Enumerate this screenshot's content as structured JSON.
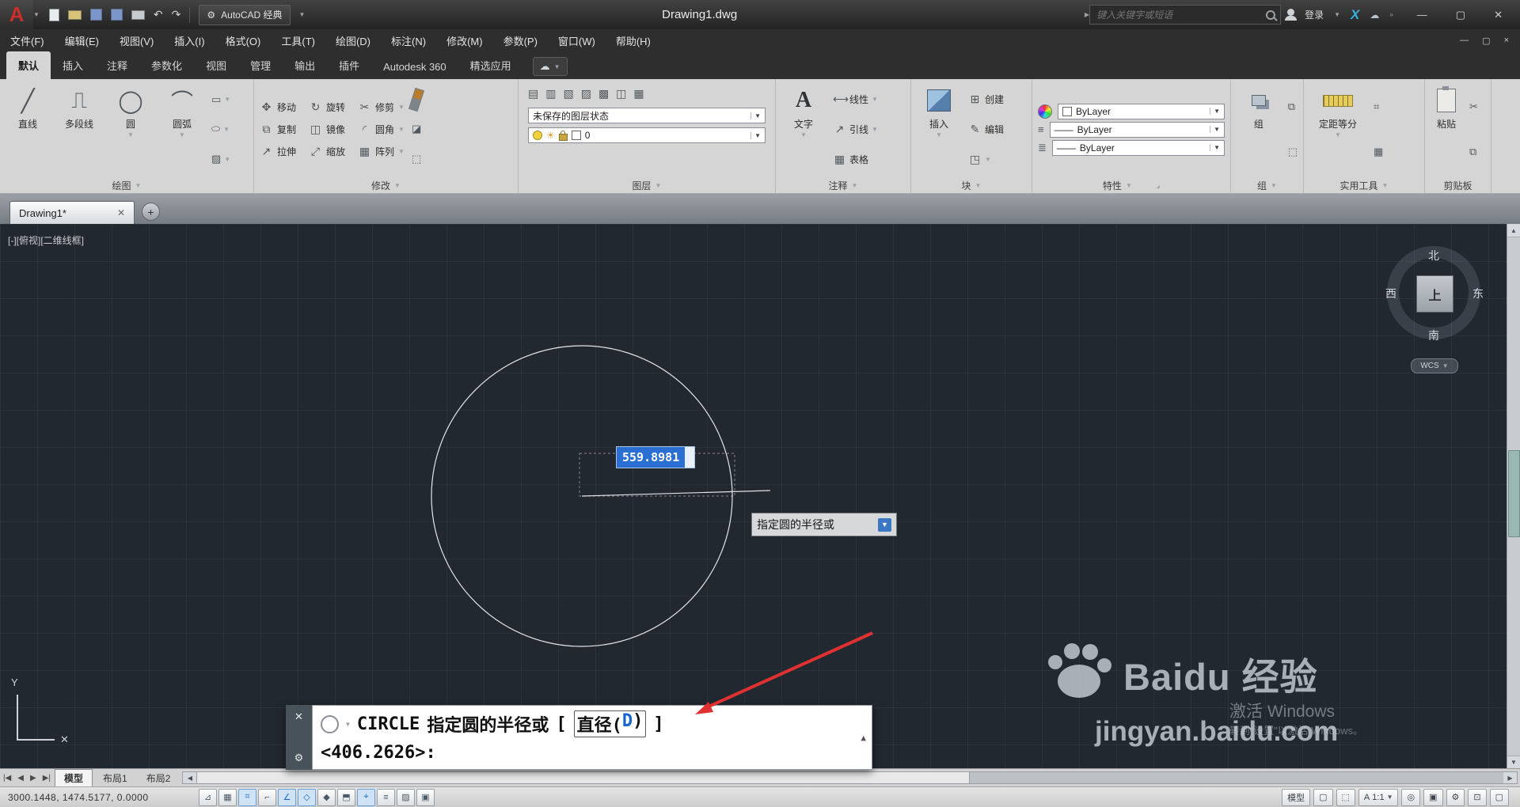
{
  "titlebar": {
    "workspace": "AutoCAD 经典",
    "doc_title": "Drawing1.dwg",
    "search_placeholder": "键入关键字或短语",
    "login": "登录"
  },
  "menubar": {
    "items": [
      "文件(F)",
      "编辑(E)",
      "视图(V)",
      "插入(I)",
      "格式(O)",
      "工具(T)",
      "绘图(D)",
      "标注(N)",
      "修改(M)",
      "参数(P)",
      "窗口(W)",
      "帮助(H)"
    ]
  },
  "ribbon": {
    "tabs": [
      "默认",
      "插入",
      "注释",
      "参数化",
      "视图",
      "管理",
      "输出",
      "插件",
      "Autodesk 360",
      "精选应用"
    ],
    "panels": {
      "draw": {
        "title": "绘图",
        "line": "直线",
        "polyline": "多段线",
        "circle": "圆",
        "arc": "圆弧"
      },
      "modify": {
        "title": "修改",
        "move": "移动",
        "rotate": "旋转",
        "trim": "修剪",
        "copy": "复制",
        "mirror": "镜像",
        "fillet": "圆角",
        "stretch": "拉伸",
        "scale": "缩放",
        "array": "阵列"
      },
      "layers": {
        "title": "图层",
        "state": "未保存的图层状态",
        "layer": "0"
      },
      "annotate": {
        "title": "注释",
        "icon_letter": "A",
        "text": "文字",
        "linear": "线性",
        "leader": "引线",
        "table": "表格"
      },
      "block": {
        "title": "块",
        "insert": "插入",
        "create": "创建",
        "edit": "编辑"
      },
      "properties": {
        "title": "特性",
        "v1": "ByLayer",
        "v2": "ByLayer",
        "v3": "ByLayer"
      },
      "groups": {
        "title": "组",
        "group": "组"
      },
      "utilities": {
        "title": "实用工具",
        "measure": "定距等分"
      },
      "clipboard": {
        "title": "剪贴板",
        "paste": "粘贴"
      }
    }
  },
  "doc_tabs": {
    "active": "Drawing1*"
  },
  "canvas": {
    "viewport_label": "[-][俯视][二维线框]",
    "dyn_input": "559.8981",
    "tooltip": "指定圆的半径或",
    "ucs_y": "Y",
    "viewcube": {
      "n": "北",
      "s": "南",
      "w": "西",
      "e": "东",
      "top": "上",
      "wcs": "WCS"
    }
  },
  "watermark": {
    "brand_left": "Bai",
    "brand_right": "du",
    "brand_cn": "经验",
    "url": "jingyan.baidu.com",
    "win1": "激活 Windows",
    "win2": "转到“设置”以激活 Windows。"
  },
  "command": {
    "cmd": "CIRCLE",
    "prompt": "指定圆的半径或",
    "bracket_open": "[",
    "option_pre": "直径(",
    "option_key": "D",
    "option_post": ")",
    "bracket_close": "]",
    "line2": "<406.2626>:"
  },
  "layout": {
    "model": "模型",
    "layout1": "布局1",
    "layout2": "布局2"
  },
  "statusbar": {
    "coords": "3000.1448, 1474.5177,  0.0000",
    "toggles": [
      {
        "name": "infer-constraints",
        "glyph": "⊿",
        "active": false
      },
      {
        "name": "snap-mode",
        "glyph": "▦",
        "active": false
      },
      {
        "name": "grid-display",
        "glyph": "⌗",
        "active": true
      },
      {
        "name": "ortho-mode",
        "glyph": "⌐",
        "active": false
      },
      {
        "name": "polar-tracking",
        "glyph": "∠",
        "active": true
      },
      {
        "name": "object-snap",
        "glyph": "◇",
        "active": true
      },
      {
        "name": "3d-object-snap",
        "glyph": "◆",
        "active": false
      },
      {
        "name": "dynamic-ucs",
        "glyph": "⬒",
        "active": false
      },
      {
        "name": "dynamic-input",
        "glyph": "⌖",
        "active": true
      },
      {
        "name": "lineweight",
        "glyph": "≡",
        "active": false
      },
      {
        "name": "transparency",
        "glyph": "▨",
        "active": false
      },
      {
        "name": "quick-properties",
        "glyph": "▣",
        "active": false
      }
    ],
    "right": {
      "model_label": "模型",
      "annotation_letter": "A",
      "scale": "1:1"
    }
  }
}
